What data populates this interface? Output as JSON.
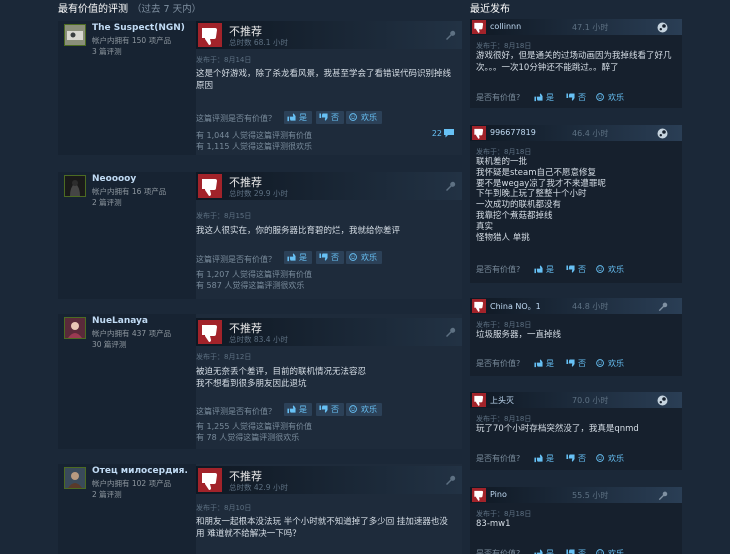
{
  "left": {
    "title": "最有价值的评测",
    "subtitle": "（过去 7 天内）",
    "helpful_question": "这篇评测是否有价值？",
    "yes_label": "是",
    "no_label": "否",
    "funny_label": "欢乐",
    "reviews": [
      {
        "author": "The Suspect(NGN)",
        "products": "帐户内拥有 150 项产品",
        "review_count": "3 篇评测",
        "verdict": "不推荐",
        "hours": "总时数 68.1 小时",
        "posted": "发布于：8月14日",
        "content": "这是个好游戏，除了杀龙看风景，我甚至学会了看错误代码识别掉线原因",
        "found_helpful": "有 1,044 人觉得这篇评测有价值",
        "found_funny": "有 1,115 人觉得这篇评测很欢乐",
        "comments": "22"
      },
      {
        "author": "Neooooy",
        "products": "帐户内拥有 16 项产品",
        "review_count": "2 篇评测",
        "verdict": "不推荐",
        "hours": "总时数 29.9 小时",
        "posted": "发布于：8月15日",
        "content": "我这人很实在，你的服务器比育碧的烂，我就给你差评",
        "found_helpful": "有 1,207 人觉得这篇评测有价值",
        "found_funny": "有 587 人觉得这篇评测很欢乐",
        "comments": ""
      },
      {
        "author": "NueLanaya",
        "products": "帐户内拥有 437 项产品",
        "review_count": "30 篇评测",
        "verdict": "不推荐",
        "hours": "总时数 83.4 小时",
        "posted": "发布于：8月12日",
        "content": "被迫无奈丢个差评，目前的联机情况无法容忍\n我不想看到很多朋友因此退坑",
        "found_helpful": "有 1,255 人觉得这篇评测有价值",
        "found_funny": "有 78 人觉得这篇评测很欢乐",
        "comments": ""
      },
      {
        "author": "Отец милосердия.",
        "products": "帐户内拥有 102 项产品",
        "review_count": "2 篇评测",
        "verdict": "不推荐",
        "hours": "总时数 42.9 小时",
        "posted": "发布于：8月10日",
        "content": "和朋友一起根本没法玩 半个小时就不知道掉了多少回 挂加速器也没用 难道就不给解决一下吗？",
        "found_helpful": "",
        "found_funny": "",
        "comments": ""
      }
    ]
  },
  "right": {
    "title": "最近发布",
    "helpful_question": "是否有价值?",
    "yes_label": "是",
    "no_label": "否",
    "funny_label": "欢乐",
    "reviews": [
      {
        "author": "collinnn",
        "hours": "47.1 小时",
        "posted": "发布于：8月18日",
        "content": "游戏很好，但是通关的过场动画因为我掉线看了好几次。。。一次10分钟还不能跳过。。醉了"
      },
      {
        "author": "996677819",
        "hours": "46.4 小时",
        "posted": "发布于：8月18日",
        "content": "联机差的一批\n我怀疑是steam自己不愿意修复\n要不是wegay凉了我才不来遭罪呢\n下午到晚上玩了整整十个小时\n一次成功的联机都没有\n我靠挖个煮菇都掉线\n真实\n怪物猎人 单挑"
      },
      {
        "author": "China NO。1",
        "hours": "44.8 小时",
        "posted": "发布于：8月18日",
        "content": "垃圾服务器，一直掉线"
      },
      {
        "author": "上头灭",
        "hours": "70.0 小时",
        "posted": "发布于：8月18日",
        "content": "玩了70个小时存档突然没了，我真是qnmd"
      },
      {
        "author": "Pino",
        "hours": "55.5 小时",
        "posted": "发布于：8月18日",
        "content": "83-mw1"
      }
    ]
  },
  "colors": {
    "thumb_down_bg": "#a2232a",
    "link_blue": "#67c1f5",
    "page_bg": "#1b2838"
  }
}
